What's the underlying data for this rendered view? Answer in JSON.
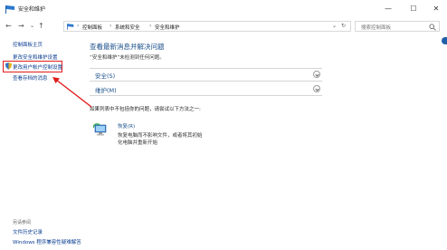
{
  "window": {
    "title": "安全和维护",
    "minimize": "—",
    "maximize": "☐",
    "close": "✕"
  },
  "nav": {
    "back": "←",
    "forward": "→",
    "dropdown": "⌄",
    "up": "↑"
  },
  "address": {
    "crumbs": [
      "控制面板",
      "系统和安全",
      "安全和维护"
    ],
    "sep": "›",
    "dropdown": "⌄",
    "refresh": "↻"
  },
  "search": {
    "placeholder": "搜索控制面板"
  },
  "sidebar": {
    "links": [
      "控制面板主页",
      "更改安全和维护设置",
      "更改用户帐户控制设置",
      "查看存档的消息"
    ],
    "see_also_heading": "另请参阅",
    "see_also": [
      "文件历史记录",
      "Windows 程序兼容性疑难解答"
    ]
  },
  "main": {
    "title": "查看最新消息并解决问题",
    "subtitle": "“安全和维护”未检测到任何问题。",
    "sections": [
      "安全(S)",
      "维护(M)"
    ],
    "hint": "如果列表中不包括你的问题，请尝试以下方法之一:",
    "restore": {
      "title": "恢复(R)",
      "desc": [
        "恢复电脑而不影响文件，或者将其初始",
        "化电脑并重新开始"
      ]
    }
  },
  "colors": {
    "annotation": "#e11b1b",
    "link": "#0a3d91",
    "heading": "#1b4f8a"
  }
}
